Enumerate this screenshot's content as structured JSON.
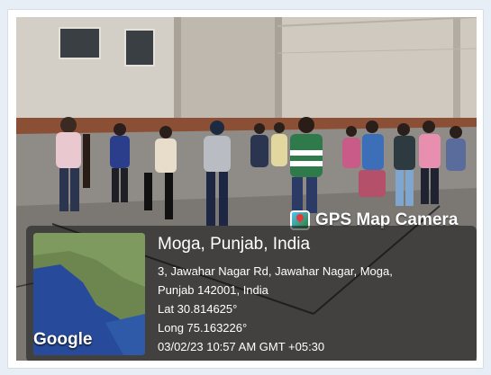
{
  "overlay": {
    "brand": "GPS Map Camera",
    "brand_icon": "map-pin-icon",
    "location_title": "Moga, Punjab, India",
    "address_line_1": "3, Jawahar Nagar Rd, Jawahar Nagar, Moga,",
    "address_line_2": "Punjab 142001, India",
    "latitude": "Lat 30.814625°",
    "longitude": "Long 75.163226°",
    "datetime": "03/02/23 10:57 AM GMT +05:30",
    "map_label": "Google"
  },
  "colors": {
    "page_background": "#e8eef6",
    "panel": "#141414",
    "text": "#ffffff"
  }
}
